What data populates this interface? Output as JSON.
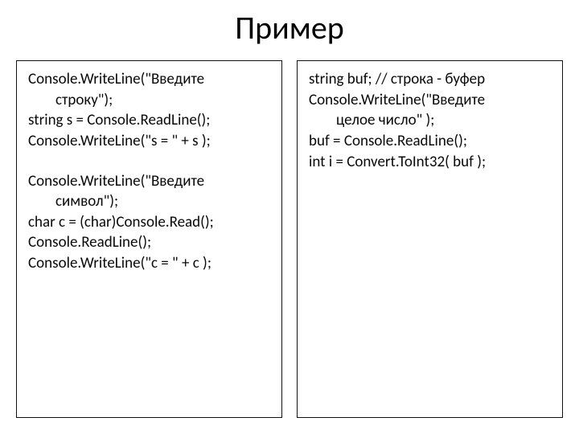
{
  "title": "Пример",
  "left": {
    "l1a": "Console.WriteLine(\"Введите",
    "l1b": "строку\");",
    "l2": " string s = Console.ReadLine();",
    "l3": " Console.WriteLine(\"s = \" + s );",
    "l4a": "Console.WriteLine(\"Введите",
    "l4b": "символ\");",
    "l5": " char с = (char)Console.Read();",
    "l6": " Console.ReadLine();",
    "l7": " Console.WriteLine(\"c = \" + с );"
  },
  "right": {
    "r1": "string buf;  // строка - буфер",
    "r2a": "Console.WriteLine(\"Введите",
    "r2b": "целое число\" );",
    "r3": "buf = Console.ReadLine();",
    "r4": "int i = Convert.ToInt32( buf );"
  }
}
